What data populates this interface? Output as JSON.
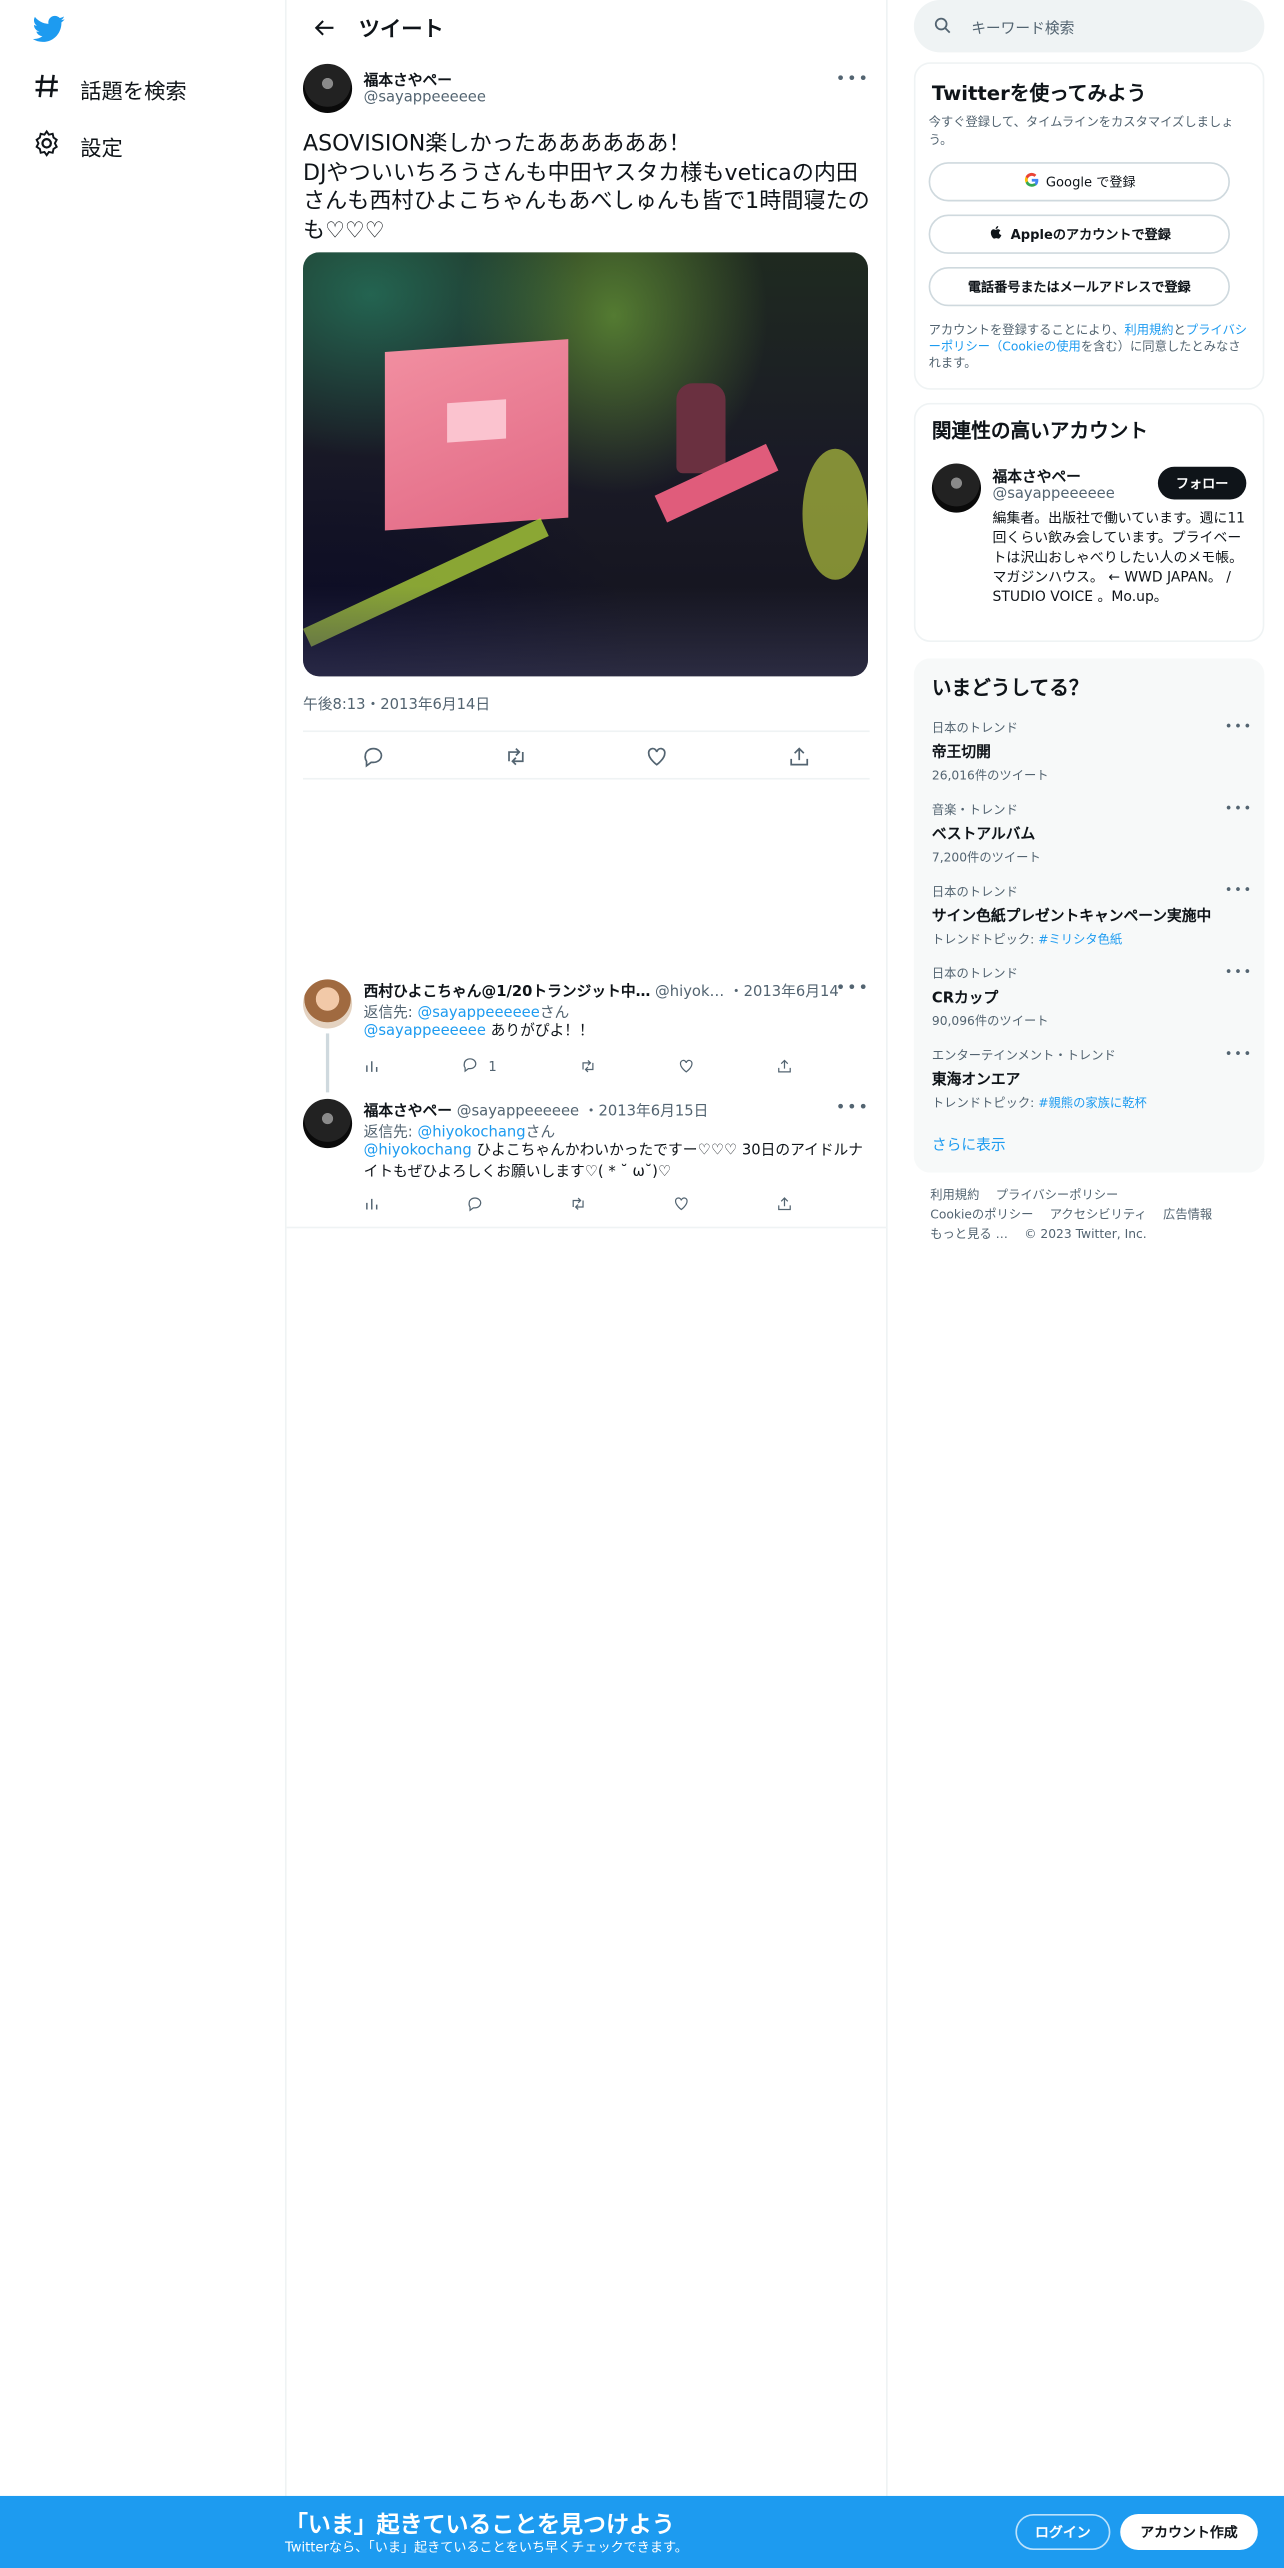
{
  "nav": {
    "logo_icon": "twitter-bird-icon",
    "items": [
      {
        "icon": "hashtag-icon",
        "label": "話題を検索"
      },
      {
        "icon": "gear-icon",
        "label": "設定"
      }
    ]
  },
  "header": {
    "title": "ツイート"
  },
  "tweet": {
    "name": "福本さやペー",
    "handle": "@sayappeeeeee",
    "text": "ASOVISION楽しかったああああああ！\nDJやついいちろうさんも中田ヤスタカ様もveticaの内田さんも西村ひよこちゃんもあべしゅんも皆で1時間寝たのも♡♡♡",
    "timestamp": "午後8:13・2013年6月14日"
  },
  "replies": [
    {
      "name": "西村ひよこちゃん@1/20トランジット中…",
      "handle": "@hiyok…",
      "date": "・2013年6月14日",
      "reply_to_label": "返信先: ",
      "reply_to_handle": "@sayappeeeeee",
      "reply_to_suffix": "さん",
      "mention": "@sayappeeeeee",
      "body": " ありがぴよ！！",
      "reply_count": "1"
    },
    {
      "name": "福本さやペー",
      "handle": "@sayappeeeeee",
      "date": "・2013年6月15日",
      "reply_to_label": "返信先: ",
      "reply_to_handle": "@hiyokochang",
      "reply_to_suffix": "さん",
      "mention": "@hiyokochang",
      "body": " ひよこちゃんかわいかったですー♡♡♡ 30日のアイドルナイトもぜひよろしくお願いします♡( * ˘ ω˘)♡",
      "reply_count": ""
    }
  ],
  "search": {
    "placeholder": "キーワード検索"
  },
  "signup": {
    "title": "Twitterを使ってみよう",
    "subtitle": "今すぐ登録して、タイムラインをカスタマイズしましょう。",
    "google": "Google で登録",
    "apple": "Appleのアカウントで登録",
    "phone": "電話番号またはメールアドレスで登録",
    "legal_pre": "アカウントを登録することにより、",
    "legal_terms": "利用規約",
    "legal_and": "と",
    "legal_privacy": "プライバシーポリシー",
    "legal_cookie": "（Cookieの使用",
    "legal_post": "を含む）に同意したとみなされます。"
  },
  "related": {
    "title": "関連性の高いアカウント",
    "name": "福本さやペー",
    "handle": "@sayappeeeeee",
    "follow": "フォロー",
    "bio": "編集者。出版社で働いています。週に11回くらい飲み会しています。プライベートは沢山おしゃべりしたい人のメモ帳。マガジンハウス。 ← WWD JAPAN。 / STUDIO VOICE 。Mo.up。"
  },
  "trends": {
    "title": "いまどうしてる？",
    "items": [
      {
        "context": "日本のトレンド",
        "name": "帝王切開",
        "meta": "26,016件のツイート",
        "topic": ""
      },
      {
        "context": "音楽・トレンド",
        "name": "ベストアルバム",
        "meta": "7,200件のツイート",
        "topic": ""
      },
      {
        "context": "日本のトレンド",
        "name": "サイン色紙プレゼントキャンペーン実施中",
        "meta": "トレンドトピック: ",
        "topic": "#ミリシタ色紙"
      },
      {
        "context": "日本のトレンド",
        "name": "CRカップ",
        "meta": "90,096件のツイート",
        "topic": ""
      },
      {
        "context": "エンターテインメント・トレンド",
        "name": "東海オンエア",
        "meta": "トレンドトピック: ",
        "topic": "#親熊の家族に乾杯"
      }
    ],
    "show_more": "さらに表示"
  },
  "footer": {
    "links": [
      "利用規約",
      "プライバシーポリシー",
      "Cookieのポリシー",
      "アクセシビリティ",
      "広告情報",
      "もっと見る …"
    ],
    "copyright": "© 2023 Twitter, Inc."
  },
  "bottom_bar": {
    "title": "「いま」起きていることを見つけよう",
    "subtitle": "Twitterなら、「いま」起きていることをいち早くチェックできます。",
    "login": "ログイン",
    "signup": "アカウント作成"
  },
  "colors": {
    "accent": "#1d9bf0",
    "text": "#0f1419",
    "muted": "#536471"
  }
}
